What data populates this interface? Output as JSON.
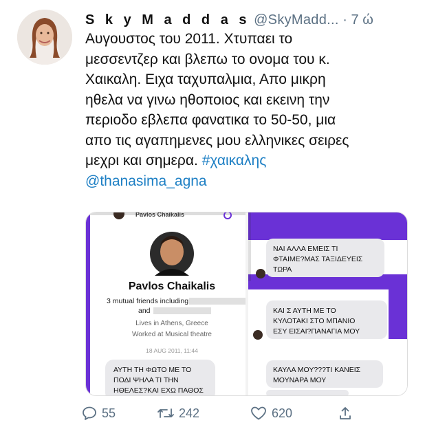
{
  "tweet": {
    "display_name": "S k y M a d d a s",
    "handle": "@SkyMadd...",
    "separator": "·",
    "time": "7 ώ",
    "text_lines": [
      "Αυγουστος του 2011. Χτυπαει το",
      "μεσσεντζερ και βλεπω το ονομα του κ.",
      "Χαικαλη. Ειχα ταχυπαλμια, Απο μικρη",
      "ηθελα να γινω ηθοποιος και εκεινη την",
      "περιοδο εβλεπα φανατικα το 50-50, μια",
      "απο τις αγαπημενες μου ελληνικες σειρες",
      "μεχρι και σημερα."
    ],
    "hashtag": "#χαικαλης",
    "mention": "@thanasima_agna"
  },
  "screenshot": {
    "top_cut_text": "Pavlos Chaikalis",
    "profile_name": "Pavlos Chaikalis",
    "mutual_friends": "3 mutual friends including",
    "and_text": "and",
    "lives": "Lives in Athens, Greece",
    "worked": "Worked at Musical theatre",
    "date": "18 AUG 2011, 11:44",
    "left_bubble": [
      "ΑΥΤΗ ΤΗ ΦΩΤΟ ΜΕ ΤΟ",
      "ΠΟΔΙ ΨΗΛΑ ΤΙ ΤΗΝ",
      "ΗΘΕΛΕΣ?ΚΑΙ ΕΧΩ ΠΑΘΟΣ"
    ],
    "right_bubble_1": [
      "ΝΑΙ ΑΛΛΑ ΕΜΕΙΣ ΤΙ",
      "ΦΤΑΙΜΕ?ΜΑΣ ΤΑΞΙΔΕΥΕΙΣ",
      "ΤΩΡΑ"
    ],
    "right_bubble_2": [
      "ΚΑΙ Σ ΑΥΤΗ ΜΕ ΤΟ",
      "ΚΥΛΟΤΑΚΙ ΣΤΟ ΜΠΑΝΙΟ",
      "ΕΣΥ ΕΙΣΑΙ?ΠΑΝΑΓΙΑ ΜΟΥ"
    ],
    "right_bubble_3": [
      "ΚΑΥΛΑ ΜΟΥ???ΤΙ ΚΑΝΕΙΣ",
      "ΜΟΥΝΑΡΑ ΜΟΥ"
    ]
  },
  "actions": {
    "replies": "55",
    "retweets": "242",
    "likes": "620"
  },
  "colors": {
    "purple": "#6a31d6",
    "link": "#1d7fc4",
    "muted": "#5b7083",
    "bubble": "#e9e9ec"
  }
}
